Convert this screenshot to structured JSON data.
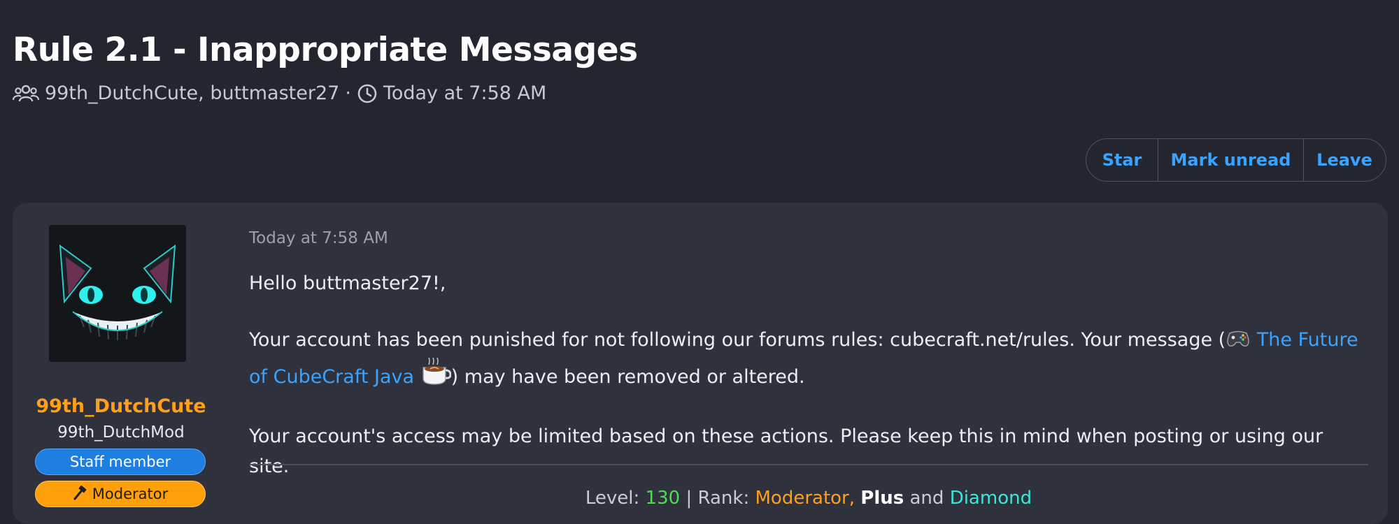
{
  "thread": {
    "title": "Rule 2.1 - Inappropriate Messages",
    "participants": "99th_DutchCute, buttmaster27",
    "separator": "·",
    "time": "Today at 7:58 AM"
  },
  "actions": {
    "star": "Star",
    "mark_unread": "Mark unread",
    "leave": "Leave"
  },
  "colors": {
    "link": "#3aa3ff",
    "username": "#ff9f1a",
    "background": "#23262f",
    "card": "#2f323d"
  },
  "post": {
    "author": {
      "username": "99th_DutchCute",
      "user_title": "99th_DutchMod",
      "staff_badge": "Staff member",
      "mod_badge": "Moderator",
      "mod_badge_icon": "hammer-icon",
      "avatar": "grinning-cat-avatar"
    },
    "time": "Today at 7:58 AM",
    "greeting": "Hello buttmaster27!,",
    "p2_before": "Your account has been punished for not following our forums rules: cubecraft.net/rules. Your message (",
    "p2_link": "The Future of CubeCraft Java",
    "p2_after": ") may have been removed or altered.",
    "p3": "Your account's access may be limited based on these actions. Please keep this in mind when posting or using our site.",
    "signature": {
      "level_label": "Level:",
      "level_value": "130",
      "sep": "|",
      "rank_label": "Rank:",
      "rank_moderator": "Moderator,",
      "rank_plus": "Plus",
      "and_word": "and",
      "rank_diamond": "Diamond"
    }
  }
}
